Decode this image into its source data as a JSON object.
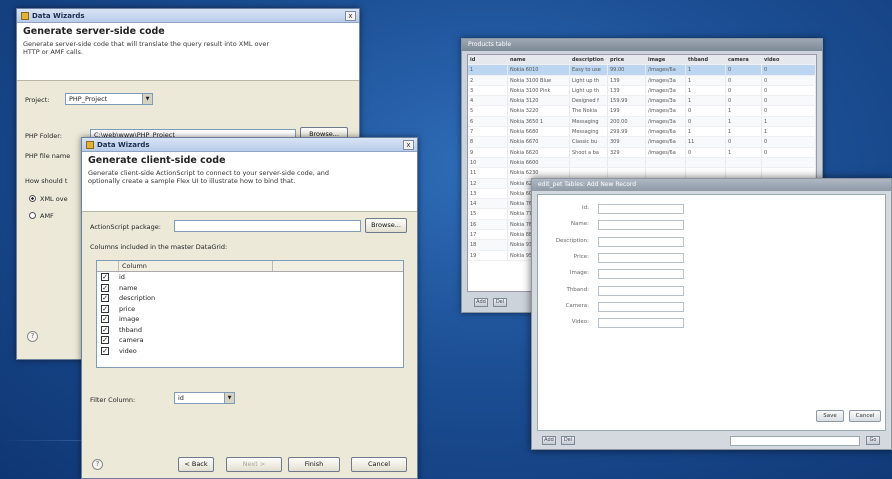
{
  "server_wizard": {
    "window_title": "Data Wizards",
    "close_label": "x",
    "heading": "Generate server-side code",
    "description": "Generate server-side code that will translate the query result into XML over HTTP or AMF calls.",
    "project_label": "Project:",
    "project_value": "PHP_Project",
    "php_folder_label": "PHP Folder:",
    "php_folder_value": "C:\\web\\www\\PHP_Project",
    "browse_label": "Browse...",
    "php_file_label": "PHP file name",
    "how_label": "How should t",
    "radio_xml": "XML ove",
    "radio_amf": "AMF",
    "help_label": "?"
  },
  "client_wizard": {
    "window_title": "Data Wizards",
    "close_label": "x",
    "heading": "Generate client-side code",
    "description": "Generate client-side ActionScript to connect to your server-side code, and optionally create a sample Flex UI to illustrate how to bind that.",
    "package_label": "ActionScript package:",
    "package_value": "",
    "browse_label": "Browse...",
    "columns_label": "Columns included in the master DataGrid:",
    "column_header": "Column",
    "columns": [
      "id",
      "name",
      "description",
      "price",
      "image",
      "thband",
      "camera",
      "video"
    ],
    "check_mark": "✓",
    "filter_label": "Filter Column:",
    "filter_value": "id",
    "back_label": "< Back",
    "next_label": "Next >",
    "finish_label": "Finish",
    "cancel_label": "Cancel",
    "help_label": "?"
  },
  "grid_window": {
    "title": "Products table",
    "headers": [
      "id",
      "name",
      "description",
      "price",
      "image",
      "thband",
      "camera",
      "video"
    ],
    "rows": [
      [
        "1",
        "Nokia 6010",
        "Easy to use",
        "99.00",
        "/images/6a",
        "1",
        "0",
        "0"
      ],
      [
        "2",
        "Nokia 3100 Blue",
        "Light up th",
        "139",
        "/images/3a",
        "1",
        "0",
        "0"
      ],
      [
        "3",
        "Nokia 3100 Pink",
        "Light up th",
        "139",
        "/images/3a",
        "1",
        "0",
        "0"
      ],
      [
        "4",
        "Nokia 3120",
        "Designed f",
        "159.99",
        "/images/3a",
        "1",
        "0",
        "0"
      ],
      [
        "5",
        "Nokia 3220",
        "The Nokia",
        "199",
        "/images/3a",
        "0",
        "1",
        "0"
      ],
      [
        "6",
        "Nokia 3650 1",
        "Messaging",
        "200.00",
        "/images/3a",
        "0",
        "1",
        "1"
      ],
      [
        "7",
        "Nokia 6680",
        "Messaging",
        "299.99",
        "/images/6a",
        "1",
        "1",
        "1"
      ],
      [
        "8",
        "Nokia 6670",
        "Classic bu",
        "309",
        "/images/6a",
        "11",
        "0",
        "0"
      ],
      [
        "9",
        "Nokia 6620",
        "Shoot a ba",
        "329",
        "/images/6a",
        "0",
        "1",
        "0"
      ],
      [
        "10",
        "Nokia 6600",
        "",
        "",
        "",
        "",
        "",
        ""
      ],
      [
        "11",
        "Nokia 6230",
        "",
        "",
        "",
        "",
        "",
        ""
      ],
      [
        "12",
        "Nokia 6220",
        "",
        "",
        "",
        "",
        "",
        ""
      ],
      [
        "13",
        "Nokia 6030",
        "",
        "",
        "",
        "",
        "",
        ""
      ],
      [
        "14",
        "Nokia 7610",
        "",
        "",
        "",
        "",
        "",
        ""
      ],
      [
        "15",
        "Nokia 7710",
        "",
        "",
        "",
        "",
        "",
        ""
      ],
      [
        "16",
        "Nokia 7650",
        "",
        "",
        "",
        "",
        "",
        ""
      ],
      [
        "17",
        "Nokia 8800",
        "",
        "",
        "",
        "",
        "",
        ""
      ],
      [
        "18",
        "Nokia 9300",
        "",
        "",
        "",
        "",
        "",
        ""
      ],
      [
        "19",
        "Nokia 9500",
        "",
        "",
        "",
        "",
        "",
        ""
      ]
    ],
    "add_label": "Add",
    "del_label": "Del"
  },
  "form_window": {
    "title": "edit_pet Tables: Add New Record",
    "fields": [
      "Id:",
      "Name:",
      "Description:",
      "Price:",
      "Image:",
      "Thband:",
      "Camera:",
      "Video:"
    ],
    "save_label": "Save",
    "cancel_label": "Cancel",
    "add_label": "Add",
    "del_label": "Del",
    "go_label": "Go"
  }
}
